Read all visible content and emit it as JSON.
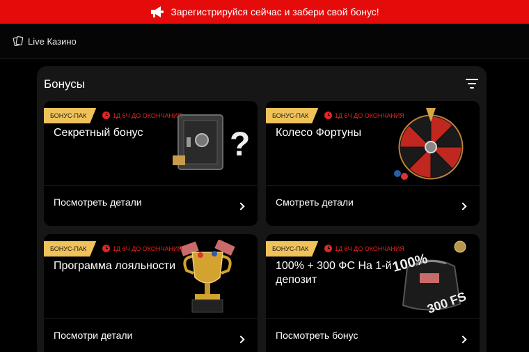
{
  "banner": {
    "text": "Зарегистрируйся сейчас и забери свой бонус!",
    "color": "#e60b0b",
    "icon": "megaphone-icon"
  },
  "nav": {
    "label": "Live Казино",
    "icon": "cards-icon"
  },
  "section": {
    "title": "Бонусы",
    "filter_icon": "filter-icon"
  },
  "accent_badge_color": "#f0c25a",
  "timer_color": "#e22424",
  "cards": [
    {
      "badge": "БОНУС-ПАК",
      "timer": "1Д 6Ч ДО ОКОНЧАНИЯ",
      "title": "Секретный бонус",
      "link": "Посмотреть детали",
      "art": "safe-icon"
    },
    {
      "badge": "БОНУС-ПАК",
      "timer": "1Д 6Ч ДО ОКОНЧАНИЯ",
      "title": "Колесо Фортуны",
      "link": "Смотреть детали",
      "art": "wheel-icon"
    },
    {
      "badge": "БОНУС-ПАК",
      "timer": "1Д 6Ч ДО ОКОНЧАНИЯ",
      "title": "Программа лояльности",
      "link": "Посмотри детали",
      "art": "trophy-icon"
    },
    {
      "badge": "БОНУС-ПАК",
      "timer": "1Д 6Ч ДО ОКОНЧАНИЯ",
      "title": "100% + 300 ФС На 1-й депозит",
      "link": "Посмотреть бонус",
      "art": "bag-icon",
      "art_text": [
        "100%",
        "300 FS"
      ]
    }
  ]
}
